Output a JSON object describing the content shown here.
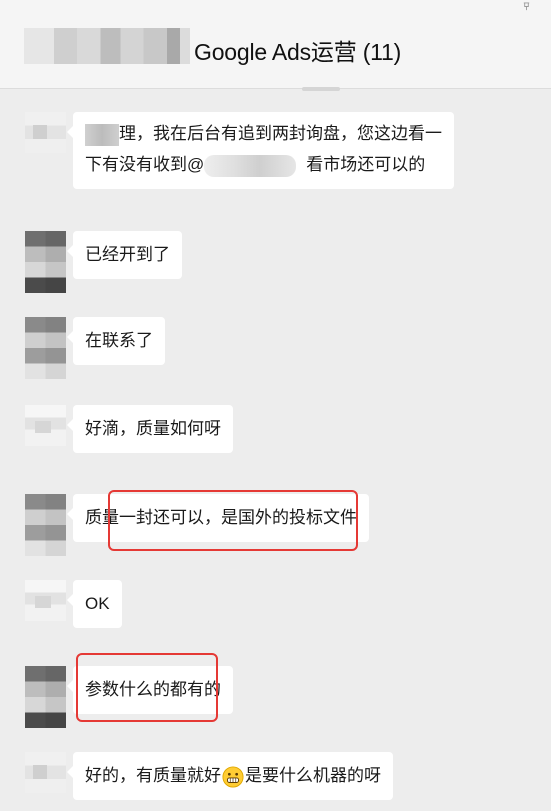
{
  "header": {
    "group_title": "Google Ads运营 (11)"
  },
  "messages": [
    {
      "line1_a": "理，我在后台有追到两封询盘，您这边看一",
      "line2_a": "下有没有收到@",
      "line2_b": "看市场还可以的"
    },
    {
      "text": "已经开到了"
    },
    {
      "text": "在联系了"
    },
    {
      "text": "好滴，质量如何呀"
    },
    {
      "text": "质量一封还可以，是国外的投标文件"
    },
    {
      "text": "OK"
    },
    {
      "text": "参数什么的都有的"
    },
    {
      "text_a": "好的，有质量就好",
      "text_b": "是要什么机器的呀",
      "emoji": "grinning-face-emoji"
    }
  ],
  "colors": {
    "highlight": "#e53935",
    "bubble": "#ffffff",
    "background": "#ededed"
  }
}
